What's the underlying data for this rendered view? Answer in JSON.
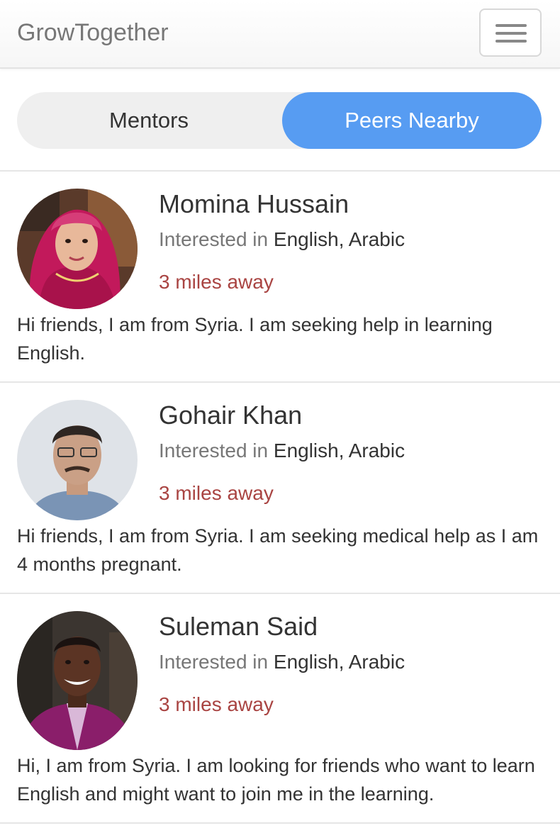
{
  "app": {
    "brand": "GrowTogether"
  },
  "tabs": [
    {
      "label": "Mentors",
      "active": false
    },
    {
      "label": "Peers Nearby",
      "active": true
    }
  ],
  "colors": {
    "accent": "#579cf2",
    "distance": "#a94442",
    "muted": "#777777"
  },
  "icons": {
    "menu": "hamburger-menu-icon"
  },
  "peers": [
    {
      "name": "Momina Hussain",
      "interest_label": "Interested in",
      "languages": "English, Arabic",
      "distance": "3 miles away",
      "bio": "Hi friends, I am from Syria. I am seeking help in learning English."
    },
    {
      "name": "Gohair Khan",
      "interest_label": "Interested in",
      "languages": "English, Arabic",
      "distance": "3 miles away",
      "bio": "Hi friends, I am from Syria. I am seeking medical help as I am 4 months pregnant."
    },
    {
      "name": "Suleman Said",
      "interest_label": "Interested in",
      "languages": "English, Arabic",
      "distance": "3 miles away",
      "bio": "Hi, I am from Syria. I am looking for friends who want to learn English and might want to join me in the learning."
    }
  ]
}
